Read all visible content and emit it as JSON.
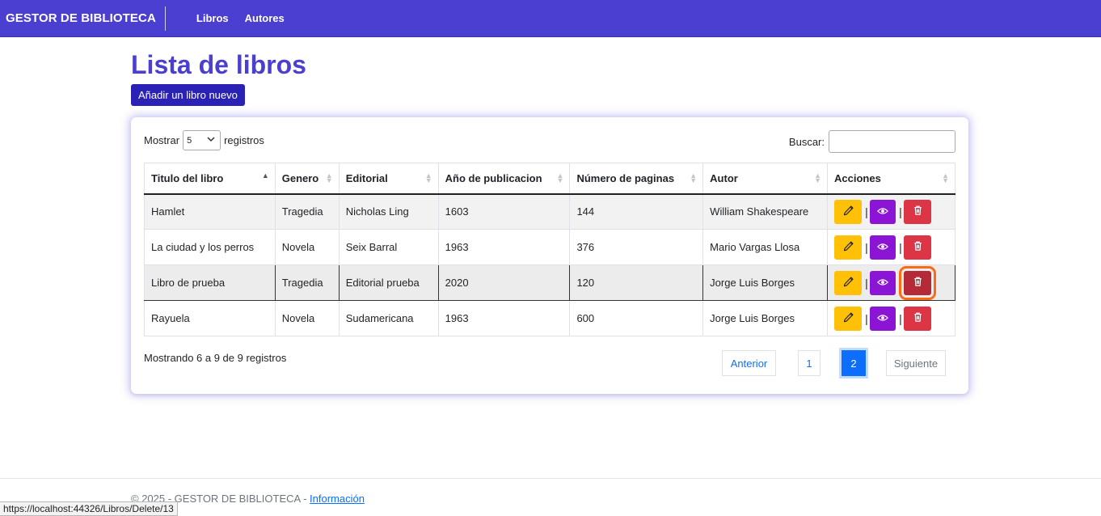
{
  "navbar": {
    "brand": "GESTOR DE BIBLIOTECA",
    "links": [
      "Libros",
      "Autores"
    ]
  },
  "page": {
    "title": "Lista de libros",
    "add_button": "Añadir un libro nuevo"
  },
  "table_controls": {
    "show_label": "Mostrar",
    "page_size": "5",
    "records_label": "registros",
    "search_label": "Buscar:",
    "search_value": ""
  },
  "table": {
    "columns": [
      "Titulo del libro",
      "Genero",
      "Editorial",
      "Año de publicacion",
      "Número de paginas",
      "Autor",
      "Acciones"
    ],
    "rows": [
      [
        "Hamlet",
        "Tragedia",
        "Nicholas Ling",
        "1603",
        "144",
        "William Shakespeare"
      ],
      [
        "La ciudad y los perros",
        "Novela",
        "Seix Barral",
        "1963",
        "376",
        "Mario Vargas Llosa"
      ],
      [
        "Libro de prueba",
        "Tragedia",
        "Editorial prueba",
        "2020",
        "120",
        "Jorge Luis Borges"
      ],
      [
        "Rayuela",
        "Novela",
        "Sudamericana",
        "1963",
        "600",
        "Jorge Luis Borges"
      ]
    ],
    "action_separator": "|"
  },
  "pagination": {
    "info": "Mostrando 6 a 9 de 9 registros",
    "previous": "Anterior",
    "pages": [
      "1",
      "2"
    ],
    "current_page": "2",
    "next": "Siguiente"
  },
  "footer": {
    "text": "© 2025 - GESTOR DE BIBLIOTECA - ",
    "link": "Información"
  },
  "status_url": "https://localhost:44326/Libros/Delete/13",
  "colors": {
    "brand": "#4a3fd1",
    "edit": "#ffc107",
    "view": "#8c14d4",
    "delete": "#dc3545",
    "focus_outline": "#fd6a12",
    "active_page": "#0d6efd"
  }
}
